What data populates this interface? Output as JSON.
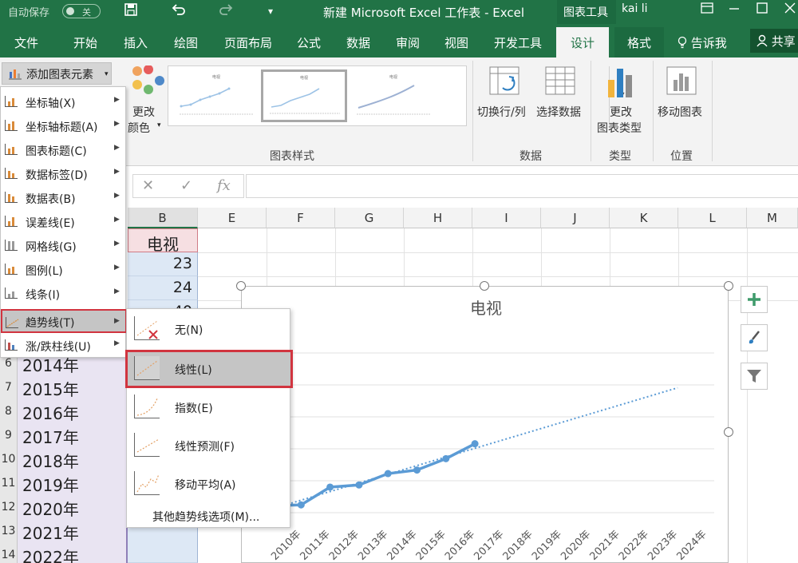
{
  "titlebar": {
    "autosave_label": "自动保存",
    "autosave_state": "关",
    "window_title": "新建 Microsoft Excel 工作表  -  Excel",
    "context_tools": "图表工具",
    "user": "kai li"
  },
  "tabs": [
    "文件",
    "开始",
    "插入",
    "绘图",
    "页面布局",
    "公式",
    "数据",
    "审阅",
    "视图",
    "开发工具",
    "设计",
    "格式"
  ],
  "tell_me": "告诉我",
  "share": "共享",
  "ribbon": {
    "add_element": "添加图表元素",
    "change_colors_1": "更改",
    "change_colors_2": "颜色",
    "switch_row_col": "切换行/列",
    "select_data": "选择数据",
    "change_type_1": "更改",
    "change_type_2": "图表类型",
    "move_chart": "移动图表",
    "groups": {
      "styles": "图表样式",
      "data": "数据",
      "type": "类型",
      "location": "位置"
    },
    "gallery_thumb_title": "电视"
  },
  "formula_bar": {
    "cancel": "✕",
    "enter": "✓",
    "fx": "fx",
    "value": ""
  },
  "columns": [
    "B",
    "E",
    "F",
    "G",
    "H",
    "I",
    "J",
    "K",
    "L",
    "M"
  ],
  "column_b": {
    "header": "电视",
    "values": [
      "23",
      "24",
      "40"
    ]
  },
  "rows": [
    {
      "num": "6",
      "year": "2014年"
    },
    {
      "num": "7",
      "year": "2015年"
    },
    {
      "num": "8",
      "year": "2016年"
    },
    {
      "num": "9",
      "year": "2017年"
    },
    {
      "num": "10",
      "year": "2018年"
    },
    {
      "num": "11",
      "year": "2019年"
    },
    {
      "num": "12",
      "year": "2020年"
    },
    {
      "num": "13",
      "year": "2021年"
    },
    {
      "num": "14",
      "year": "2022年"
    }
  ],
  "menu": {
    "items": [
      {
        "label": "坐标轴(X)"
      },
      {
        "label": "坐标轴标题(A)"
      },
      {
        "label": "图表标题(C)"
      },
      {
        "label": "数据标签(D)"
      },
      {
        "label": "数据表(B)"
      },
      {
        "label": "误差线(E)"
      },
      {
        "label": "网格线(G)"
      },
      {
        "label": "图例(L)"
      },
      {
        "label": "线条(I)"
      },
      {
        "label": "趋势线(T)"
      },
      {
        "label": "涨/跌柱线(U)"
      }
    ],
    "highlight_index": 9
  },
  "submenu": {
    "items": [
      {
        "label": "无(N)"
      },
      {
        "label": "线性(L)"
      },
      {
        "label": "指数(E)"
      },
      {
        "label": "线性预测(F)"
      },
      {
        "label": "移动平均(A)"
      }
    ],
    "highlight_index": 1,
    "footer": "其他趋势线选项(M)..."
  },
  "chart_data": {
    "type": "line",
    "title": "电视",
    "categories": [
      "2010年",
      "2011年",
      "2012年",
      "2013年",
      "2014年",
      "2015年",
      "2016年",
      "2017年",
      "2018年",
      "2019年",
      "2020年",
      "2021年",
      "2022年",
      "2023年",
      "2024年"
    ],
    "series": [
      {
        "values": [
          10,
          11,
          36,
          39,
          55,
          60,
          76,
          97,
          null,
          null,
          null,
          null,
          null,
          null,
          null
        ]
      }
    ],
    "trendline": {
      "type": "linear",
      "forecast_to": "2024年"
    },
    "color": "#5b9bd5"
  },
  "colors": {
    "accent": "#217346",
    "highlight_border": "#d1343f"
  }
}
